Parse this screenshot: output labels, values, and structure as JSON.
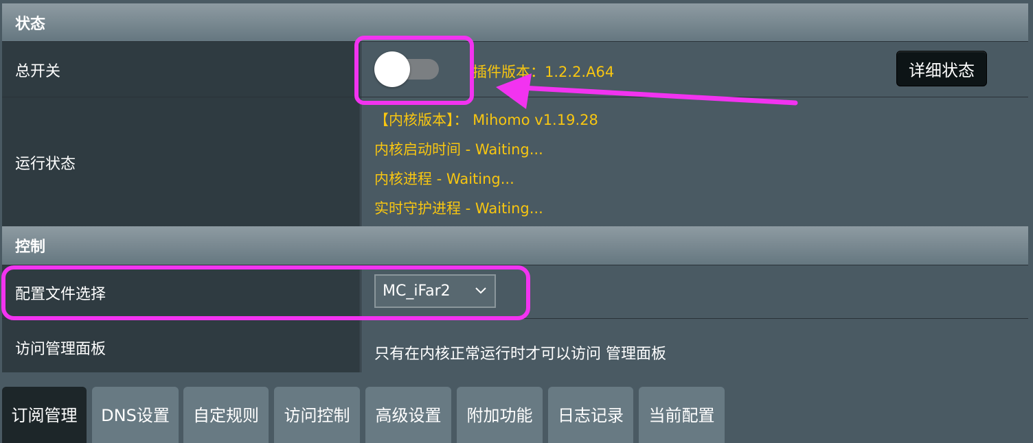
{
  "status_section": {
    "title": "状态"
  },
  "master_switch": {
    "label": "总开关",
    "state": "off",
    "plugin_version": "插件版本：1.2.2.A64",
    "detail_button": "详细状态"
  },
  "run_status": {
    "label": "运行状态",
    "lines": [
      "【内核版本】： Mihomo v1.19.28",
      "内核启动时间 - Waiting...",
      "内核进程 - Waiting...",
      "实时守护进程 - Waiting..."
    ]
  },
  "control_section": {
    "title": "控制"
  },
  "config_select": {
    "label": "配置文件选择",
    "value": "MC_iFar2"
  },
  "panel_access": {
    "label": "访问管理面板",
    "text": "只有在内核正常运行时才可以访问 管理面板"
  },
  "tabs": [
    "订阅管理",
    "DNS设置",
    "自定规则",
    "访问控制",
    "高级设置",
    "附加功能",
    "日志记录",
    "当前配置"
  ],
  "colors": {
    "highlight": "#f233f0",
    "status_text": "#f8c611",
    "accent_header": "#7d8c93"
  },
  "icons": {
    "select_chevron": "chevron-down-icon"
  }
}
